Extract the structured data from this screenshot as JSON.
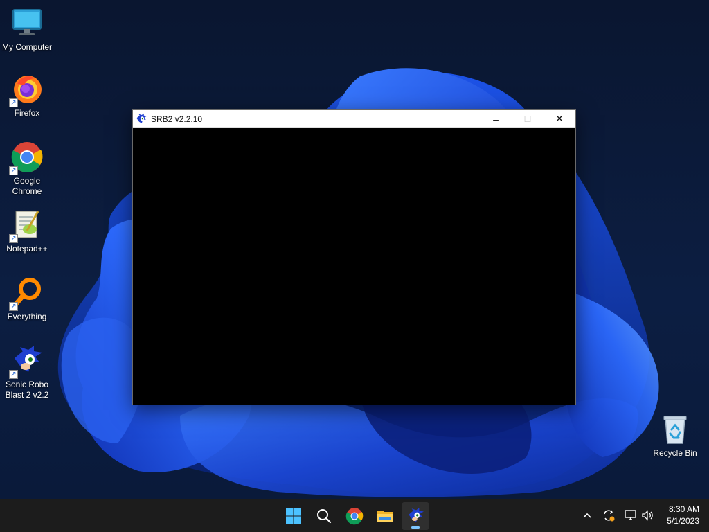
{
  "desktop": {
    "icons": [
      {
        "label": "My Computer",
        "icon": "monitor-icon",
        "shortcut": false
      },
      {
        "label": "Firefox",
        "icon": "firefox-icon",
        "shortcut": true
      },
      {
        "label": "Google Chrome",
        "icon": "chrome-icon",
        "shortcut": true
      },
      {
        "label": "Notepad++",
        "icon": "notepadpp-icon",
        "shortcut": true
      },
      {
        "label": "Everything",
        "icon": "everything-search-icon",
        "shortcut": true
      },
      {
        "label": "Sonic Robo Blast 2 v2.2",
        "icon": "sonic-icon",
        "shortcut": true
      }
    ],
    "recycle_bin": {
      "label": "Recycle Bin",
      "icon": "recycle-bin-icon"
    }
  },
  "window": {
    "title": "SRB2 v2.2.10",
    "icon": "sonic-icon",
    "controls": {
      "minimize": "–",
      "maximize": "☐",
      "close": "✕"
    },
    "content_color": "#000000"
  },
  "taskbar": {
    "apps": [
      {
        "name": "start-button",
        "icon": "windows-logo-icon",
        "active": false
      },
      {
        "name": "search-button",
        "icon": "search-icon",
        "active": false
      },
      {
        "name": "taskbar-chrome",
        "icon": "chrome-icon",
        "active": false
      },
      {
        "name": "taskbar-file-explorer",
        "icon": "folder-icon",
        "active": false
      },
      {
        "name": "taskbar-srb2",
        "icon": "sonic-icon",
        "active": true
      }
    ],
    "tray": {
      "overflow": "^",
      "icons": [
        "update-icon",
        "network-icon",
        "volume-icon"
      ]
    },
    "clock": {
      "time": "8:30 AM",
      "date": "5/1/2023"
    }
  },
  "colors": {
    "accent": "#7ec6ff",
    "taskbar_bg": "#1c1c1c",
    "wallpaper_blue": "#1e4fe0"
  }
}
